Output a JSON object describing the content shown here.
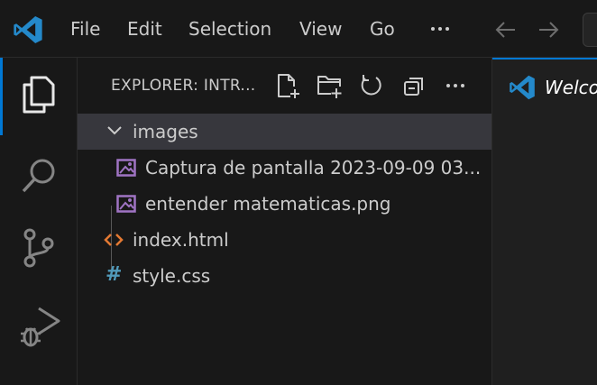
{
  "titlebar": {
    "menu": [
      "File",
      "Edit",
      "Selection",
      "View",
      "Go"
    ],
    "more_icon": "ellipsis-icon",
    "back_icon": "arrow-left-icon",
    "forward_icon": "arrow-right-icon"
  },
  "activitybar": {
    "items": [
      {
        "name": "explorer",
        "icon": "files-icon",
        "active": true
      },
      {
        "name": "search",
        "icon": "search-icon",
        "active": false
      },
      {
        "name": "source-control",
        "icon": "source-control-icon",
        "active": false
      },
      {
        "name": "run-and-debug",
        "icon": "run-debug-icon",
        "active": false
      }
    ]
  },
  "sidebar": {
    "title": "EXPLORER: INTR...",
    "actions": [
      "new-file-icon",
      "new-folder-icon",
      "refresh-icon",
      "collapse-all-icon",
      "ellipsis-icon"
    ],
    "tree": [
      {
        "label": "images",
        "type": "folder",
        "expanded": true,
        "selected": true,
        "icon": "chevron-down-icon"
      },
      {
        "label": "Captura de pantalla 2023-09-09 03...",
        "type": "image",
        "icon": "image-file-icon"
      },
      {
        "label": "entender matematicas.png",
        "type": "image",
        "icon": "image-file-icon"
      },
      {
        "label": "index.html",
        "type": "html",
        "icon": "html-file-icon"
      },
      {
        "label": "style.css",
        "type": "css",
        "icon": "css-file-icon",
        "glyph": "#"
      }
    ]
  },
  "editor": {
    "tabs": [
      {
        "label": "Welco",
        "icon": "vscode-logo-icon",
        "active": true,
        "italic": true
      }
    ]
  },
  "colors": {
    "accent": "#0078d4",
    "background": "#181818",
    "selected_row": "#37373d",
    "html_icon": "#e37933",
    "css_icon": "#519aba",
    "image_icon": "#a074c4",
    "logo": "#2489ca"
  }
}
